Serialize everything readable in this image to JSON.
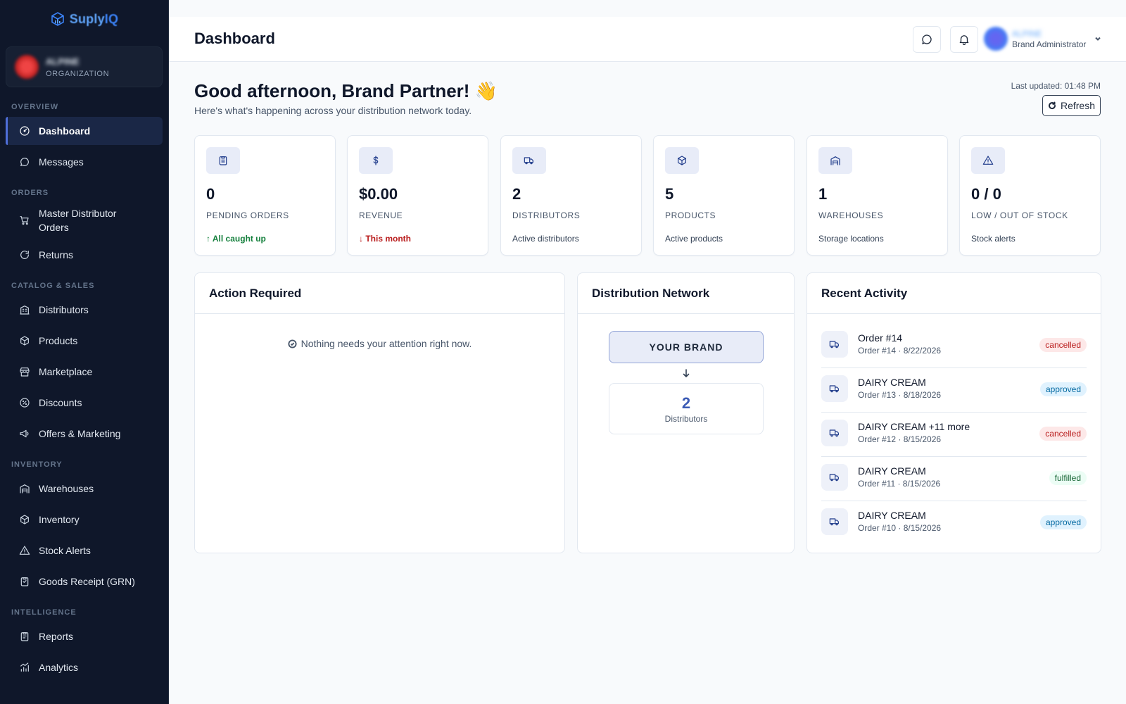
{
  "app": {
    "logo_text": "Suply",
    "logo_text_accent": "IQ",
    "org_name": "ALPINE",
    "org_sub": "ORGANIZATION"
  },
  "sidebar": {
    "sections": [
      {
        "title": "OVERVIEW",
        "items": [
          {
            "label": "Dashboard",
            "icon": "gauge-icon",
            "active": true
          },
          {
            "label": "Messages",
            "icon": "chat-icon"
          }
        ]
      },
      {
        "title": "ORDERS",
        "items": [
          {
            "label": "Master Distributor Orders",
            "icon": "cart-icon"
          },
          {
            "label": "Returns",
            "icon": "return-icon"
          }
        ]
      },
      {
        "title": "CATALOG & SALES",
        "items": [
          {
            "label": "Distributors",
            "icon": "building-icon"
          },
          {
            "label": "Products",
            "icon": "box-icon"
          },
          {
            "label": "Marketplace",
            "icon": "store-icon"
          },
          {
            "label": "Discounts",
            "icon": "discount-icon"
          },
          {
            "label": "Offers & Marketing",
            "icon": "megaphone-icon"
          }
        ]
      },
      {
        "title": "INVENTORY",
        "items": [
          {
            "label": "Warehouses",
            "icon": "warehouse-icon"
          },
          {
            "label": "Inventory",
            "icon": "box-icon"
          },
          {
            "label": "Stock Alerts",
            "icon": "alert-icon"
          },
          {
            "label": "Goods Receipt (GRN)",
            "icon": "clipboard-icon"
          }
        ]
      },
      {
        "title": "INTELLIGENCE",
        "items": [
          {
            "label": "Reports",
            "icon": "report-icon"
          },
          {
            "label": "Analytics",
            "icon": "chart-icon"
          }
        ]
      }
    ]
  },
  "header": {
    "title": "Dashboard",
    "user_name": "ALPINE",
    "user_role": "Brand Administrator"
  },
  "main": {
    "greeting": "Good afternoon, Brand Partner! 👋",
    "subgreeting": "Here's what's happening across your distribution network today.",
    "last_updated": "Last updated: 01:48 PM",
    "refresh_label": "Refresh",
    "stats": [
      {
        "value": "0",
        "label": "PENDING ORDERS",
        "note": "↑ All caught up",
        "note_tone": "good",
        "icon": "clipboard-icon"
      },
      {
        "value": "$0.00",
        "label": "REVENUE",
        "note": "↓ This month",
        "note_tone": "bad",
        "icon": "dollar-icon"
      },
      {
        "value": "2",
        "label": "DISTRIBUTORS",
        "note": "Active distributors",
        "note_tone": "neutral",
        "icon": "truck-icon"
      },
      {
        "value": "5",
        "label": "PRODUCTS",
        "note": "Active products",
        "note_tone": "neutral",
        "icon": "box-icon"
      },
      {
        "value": "1",
        "label": "WAREHOUSES",
        "note": "Storage locations",
        "note_tone": "neutral",
        "icon": "warehouse-icon"
      },
      {
        "value": "0 / 0",
        "label": "LOW / OUT OF STOCK",
        "note": "Stock alerts",
        "note_tone": "neutral",
        "icon": "alert-icon"
      }
    ],
    "action_required": {
      "title": "Action Required",
      "empty_message": "Nothing needs your attention right now."
    },
    "distribution_network": {
      "title": "Distribution Network",
      "brand_label": "YOUR BRAND",
      "distributor_count": "2",
      "distributor_label": "Distributors"
    },
    "recent_activity": {
      "title": "Recent Activity",
      "items": [
        {
          "title": "Order #14",
          "sub": "Order #14 · 8/22/2026",
          "status": "cancelled"
        },
        {
          "title": "DAIRY CREAM",
          "sub": "Order #13 · 8/18/2026",
          "status": "approved"
        },
        {
          "title": "DAIRY CREAM +11 more",
          "sub": "Order #12 · 8/15/2026",
          "status": "cancelled"
        },
        {
          "title": "DAIRY CREAM",
          "sub": "Order #11 · 8/15/2026",
          "status": "fulfilled"
        },
        {
          "title": "DAIRY CREAM",
          "sub": "Order #10 · 8/15/2026",
          "status": "approved"
        }
      ]
    }
  },
  "colors": {
    "sidebar_bg": "#0f172a",
    "accent": "#4f6fd9",
    "good": "#15803d",
    "bad": "#b91c1c"
  }
}
